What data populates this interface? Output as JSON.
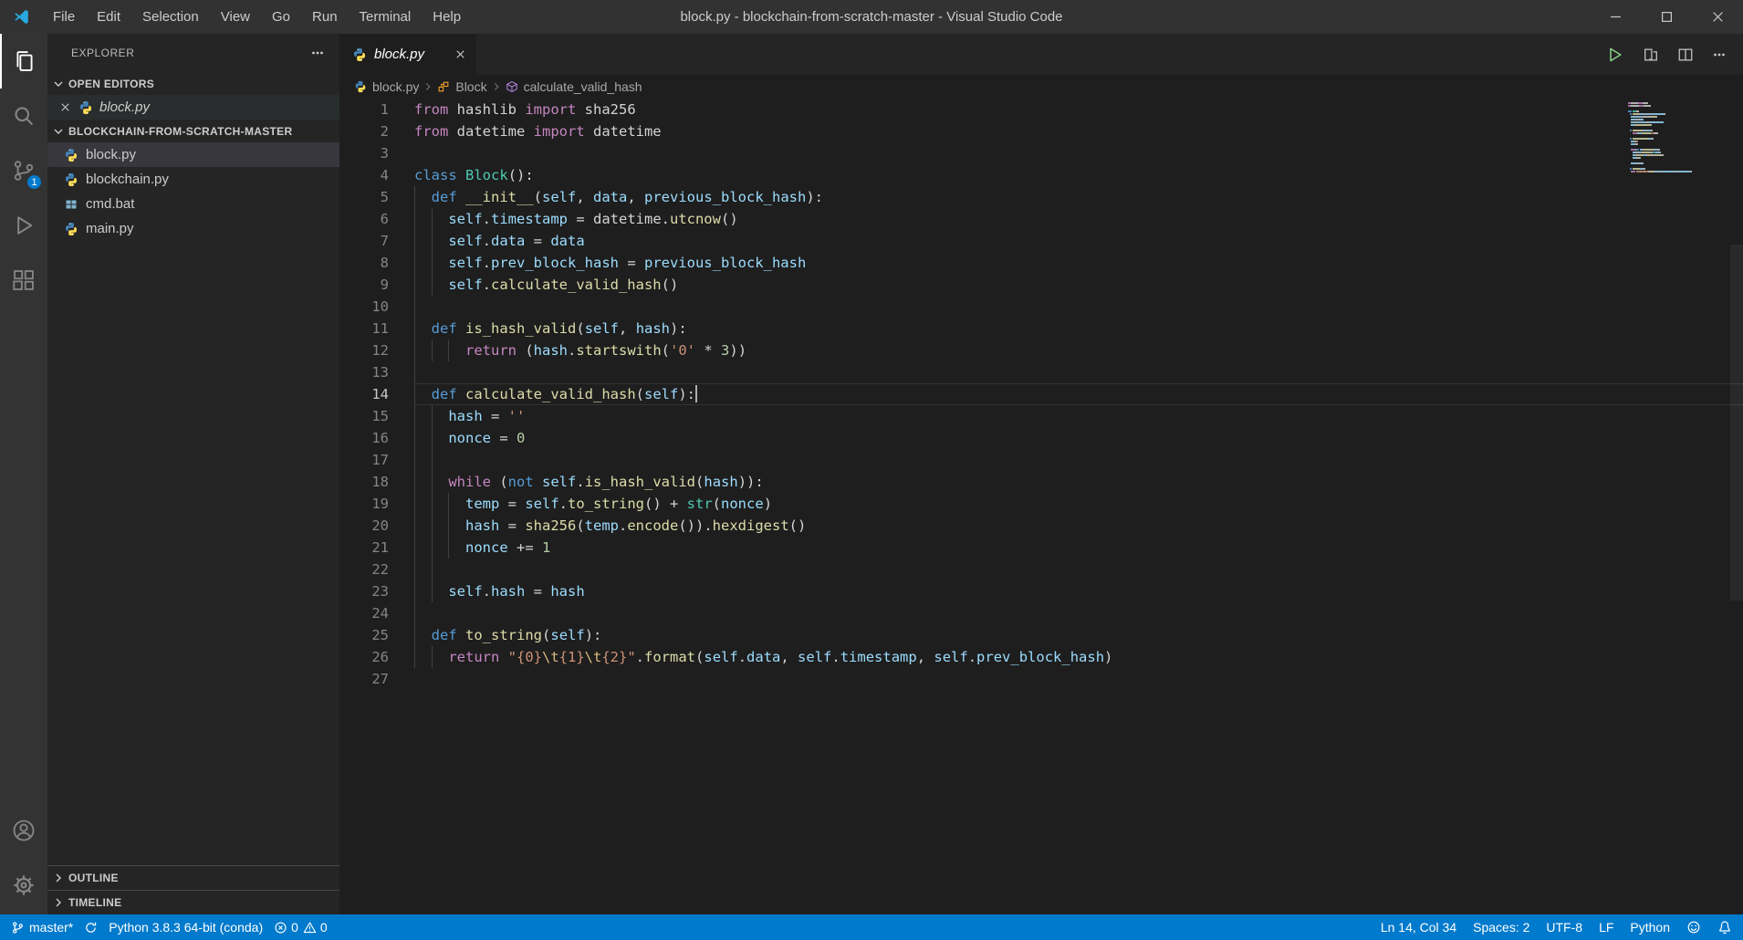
{
  "title_bar": {
    "title": "block.py - blockchain-from-scratch-master - Visual Studio Code",
    "menus": [
      "File",
      "Edit",
      "Selection",
      "View",
      "Go",
      "Run",
      "Terminal",
      "Help"
    ]
  },
  "activity_bar": {
    "scm_badge": "1"
  },
  "sidebar": {
    "title": "EXPLORER",
    "open_editors": {
      "label": "OPEN EDITORS",
      "items": [
        {
          "file": "block.py"
        }
      ]
    },
    "folder": {
      "label": "BLOCKCHAIN-FROM-SCRATCH-MASTER",
      "files": [
        {
          "name": "block.py",
          "icon": "python",
          "selected": true
        },
        {
          "name": "blockchain.py",
          "icon": "python",
          "selected": false
        },
        {
          "name": "cmd.bat",
          "icon": "bat",
          "selected": false
        },
        {
          "name": "main.py",
          "icon": "python",
          "selected": false
        }
      ]
    },
    "sections": [
      "OUTLINE",
      "TIMELINE"
    ]
  },
  "editor": {
    "tab": {
      "label": "block.py"
    },
    "breadcrumbs": [
      "block.py",
      "Block",
      "calculate_valid_hash"
    ],
    "active_line": 14,
    "cursor": {
      "line": 14,
      "col": 34
    },
    "code": {
      "token_colors": {
        "d": "#d4d4d4",
        "c": "#c586c0",
        "k": "#569cd6",
        "t": "#4ec9b0",
        "f": "#dcdcaa",
        "v": "#9cdcfe",
        "s": "#ce9178",
        "e": "#d7ba7d",
        "n": "#b5cea8"
      },
      "lines": [
        [
          [
            "c",
            "from"
          ],
          [
            "d",
            " hashlib "
          ],
          [
            "c",
            "import"
          ],
          [
            "d",
            " sha256"
          ]
        ],
        [
          [
            "c",
            "from"
          ],
          [
            "d",
            " datetime "
          ],
          [
            "c",
            "import"
          ],
          [
            "d",
            " datetime"
          ]
        ],
        [],
        [
          [
            "k",
            "class"
          ],
          [
            "d",
            " "
          ],
          [
            "t",
            "Block"
          ],
          [
            "d",
            "():"
          ]
        ],
        [
          [
            "d",
            "  "
          ],
          [
            "k",
            "def"
          ],
          [
            "d",
            " "
          ],
          [
            "f",
            "__init__"
          ],
          [
            "d",
            "("
          ],
          [
            "v",
            "self"
          ],
          [
            "d",
            ", "
          ],
          [
            "v",
            "data"
          ],
          [
            "d",
            ", "
          ],
          [
            "v",
            "previous_block_hash"
          ],
          [
            "d",
            "):"
          ]
        ],
        [
          [
            "d",
            "    "
          ],
          [
            "v",
            "self"
          ],
          [
            "d",
            "."
          ],
          [
            "v",
            "timestamp"
          ],
          [
            "d",
            " = datetime."
          ],
          [
            "f",
            "utcnow"
          ],
          [
            "d",
            "()"
          ]
        ],
        [
          [
            "d",
            "    "
          ],
          [
            "v",
            "self"
          ],
          [
            "d",
            "."
          ],
          [
            "v",
            "data"
          ],
          [
            "d",
            " = "
          ],
          [
            "v",
            "data"
          ]
        ],
        [
          [
            "d",
            "    "
          ],
          [
            "v",
            "self"
          ],
          [
            "d",
            "."
          ],
          [
            "v",
            "prev_block_hash"
          ],
          [
            "d",
            " = "
          ],
          [
            "v",
            "previous_block_hash"
          ]
        ],
        [
          [
            "d",
            "    "
          ],
          [
            "v",
            "self"
          ],
          [
            "d",
            "."
          ],
          [
            "f",
            "calculate_valid_hash"
          ],
          [
            "d",
            "()"
          ]
        ],
        [],
        [
          [
            "d",
            "  "
          ],
          [
            "k",
            "def"
          ],
          [
            "d",
            " "
          ],
          [
            "f",
            "is_hash_valid"
          ],
          [
            "d",
            "("
          ],
          [
            "v",
            "self"
          ],
          [
            "d",
            ", "
          ],
          [
            "v",
            "hash"
          ],
          [
            "d",
            "):"
          ]
        ],
        [
          [
            "d",
            "      "
          ],
          [
            "c",
            "return"
          ],
          [
            "d",
            " ("
          ],
          [
            "v",
            "hash"
          ],
          [
            "d",
            "."
          ],
          [
            "f",
            "startswith"
          ],
          [
            "d",
            "("
          ],
          [
            "s",
            "'0'"
          ],
          [
            "d",
            " * "
          ],
          [
            "n",
            "3"
          ],
          [
            "d",
            "))"
          ]
        ],
        [],
        [
          [
            "d",
            "  "
          ],
          [
            "k",
            "def"
          ],
          [
            "d",
            " "
          ],
          [
            "f",
            "calculate_valid_hash"
          ],
          [
            "d",
            "("
          ],
          [
            "v",
            "self"
          ],
          [
            "d",
            "):"
          ]
        ],
        [
          [
            "d",
            "    "
          ],
          [
            "v",
            "hash"
          ],
          [
            "d",
            " = "
          ],
          [
            "s",
            "''"
          ]
        ],
        [
          [
            "d",
            "    "
          ],
          [
            "v",
            "nonce"
          ],
          [
            "d",
            " = "
          ],
          [
            "n",
            "0"
          ]
        ],
        [],
        [
          [
            "d",
            "    "
          ],
          [
            "c",
            "while"
          ],
          [
            "d",
            " ("
          ],
          [
            "k",
            "not"
          ],
          [
            "d",
            " "
          ],
          [
            "v",
            "self"
          ],
          [
            "d",
            "."
          ],
          [
            "f",
            "is_hash_valid"
          ],
          [
            "d",
            "("
          ],
          [
            "v",
            "hash"
          ],
          [
            "d",
            ")):"
          ]
        ],
        [
          [
            "d",
            "      "
          ],
          [
            "v",
            "temp"
          ],
          [
            "d",
            " = "
          ],
          [
            "v",
            "self"
          ],
          [
            "d",
            "."
          ],
          [
            "f",
            "to_string"
          ],
          [
            "d",
            "() + "
          ],
          [
            "t",
            "str"
          ],
          [
            "d",
            "("
          ],
          [
            "v",
            "nonce"
          ],
          [
            "d",
            ")"
          ]
        ],
        [
          [
            "d",
            "      "
          ],
          [
            "v",
            "hash"
          ],
          [
            "d",
            " = "
          ],
          [
            "f",
            "sha256"
          ],
          [
            "d",
            "("
          ],
          [
            "v",
            "temp"
          ],
          [
            "d",
            "."
          ],
          [
            "f",
            "encode"
          ],
          [
            "d",
            "())."
          ],
          [
            "f",
            "hexdigest"
          ],
          [
            "d",
            "()"
          ]
        ],
        [
          [
            "d",
            "      "
          ],
          [
            "v",
            "nonce"
          ],
          [
            "d",
            " += "
          ],
          [
            "n",
            "1"
          ]
        ],
        [],
        [
          [
            "d",
            "    "
          ],
          [
            "v",
            "self"
          ],
          [
            "d",
            "."
          ],
          [
            "v",
            "hash"
          ],
          [
            "d",
            " = "
          ],
          [
            "v",
            "hash"
          ]
        ],
        [],
        [
          [
            "d",
            "  "
          ],
          [
            "k",
            "def"
          ],
          [
            "d",
            " "
          ],
          [
            "f",
            "to_string"
          ],
          [
            "d",
            "("
          ],
          [
            "v",
            "self"
          ],
          [
            "d",
            "):"
          ]
        ],
        [
          [
            "d",
            "    "
          ],
          [
            "c",
            "return"
          ],
          [
            "d",
            " "
          ],
          [
            "s",
            "\"{0}"
          ],
          [
            "e",
            "\\t"
          ],
          [
            "s",
            "{1}"
          ],
          [
            "e",
            "\\t"
          ],
          [
            "s",
            "{2}\""
          ],
          [
            "d",
            "."
          ],
          [
            "f",
            "format"
          ],
          [
            "d",
            "("
          ],
          [
            "v",
            "self"
          ],
          [
            "d",
            "."
          ],
          [
            "v",
            "data"
          ],
          [
            "d",
            ", "
          ],
          [
            "v",
            "self"
          ],
          [
            "d",
            "."
          ],
          [
            "v",
            "timestamp"
          ],
          [
            "d",
            ", "
          ],
          [
            "v",
            "self"
          ],
          [
            "d",
            "."
          ],
          [
            "v",
            "prev_block_hash"
          ],
          [
            "d",
            ")"
          ]
        ],
        []
      ]
    }
  },
  "status_bar": {
    "left": {
      "branch": "master*",
      "interpreter": "Python 3.8.3 64-bit (conda)",
      "errors": "0",
      "warnings": "0"
    },
    "right": {
      "position": "Ln 14, Col 34",
      "indent": "Spaces: 2",
      "encoding": "UTF-8",
      "eol": "LF",
      "language": "Python"
    }
  },
  "colors": {
    "accent": "#007acc",
    "titlebar": "#323233",
    "activitybar": "#333333",
    "sidebar": "#252526",
    "editor": "#1e1e1e",
    "statusbar": "#007acc"
  }
}
